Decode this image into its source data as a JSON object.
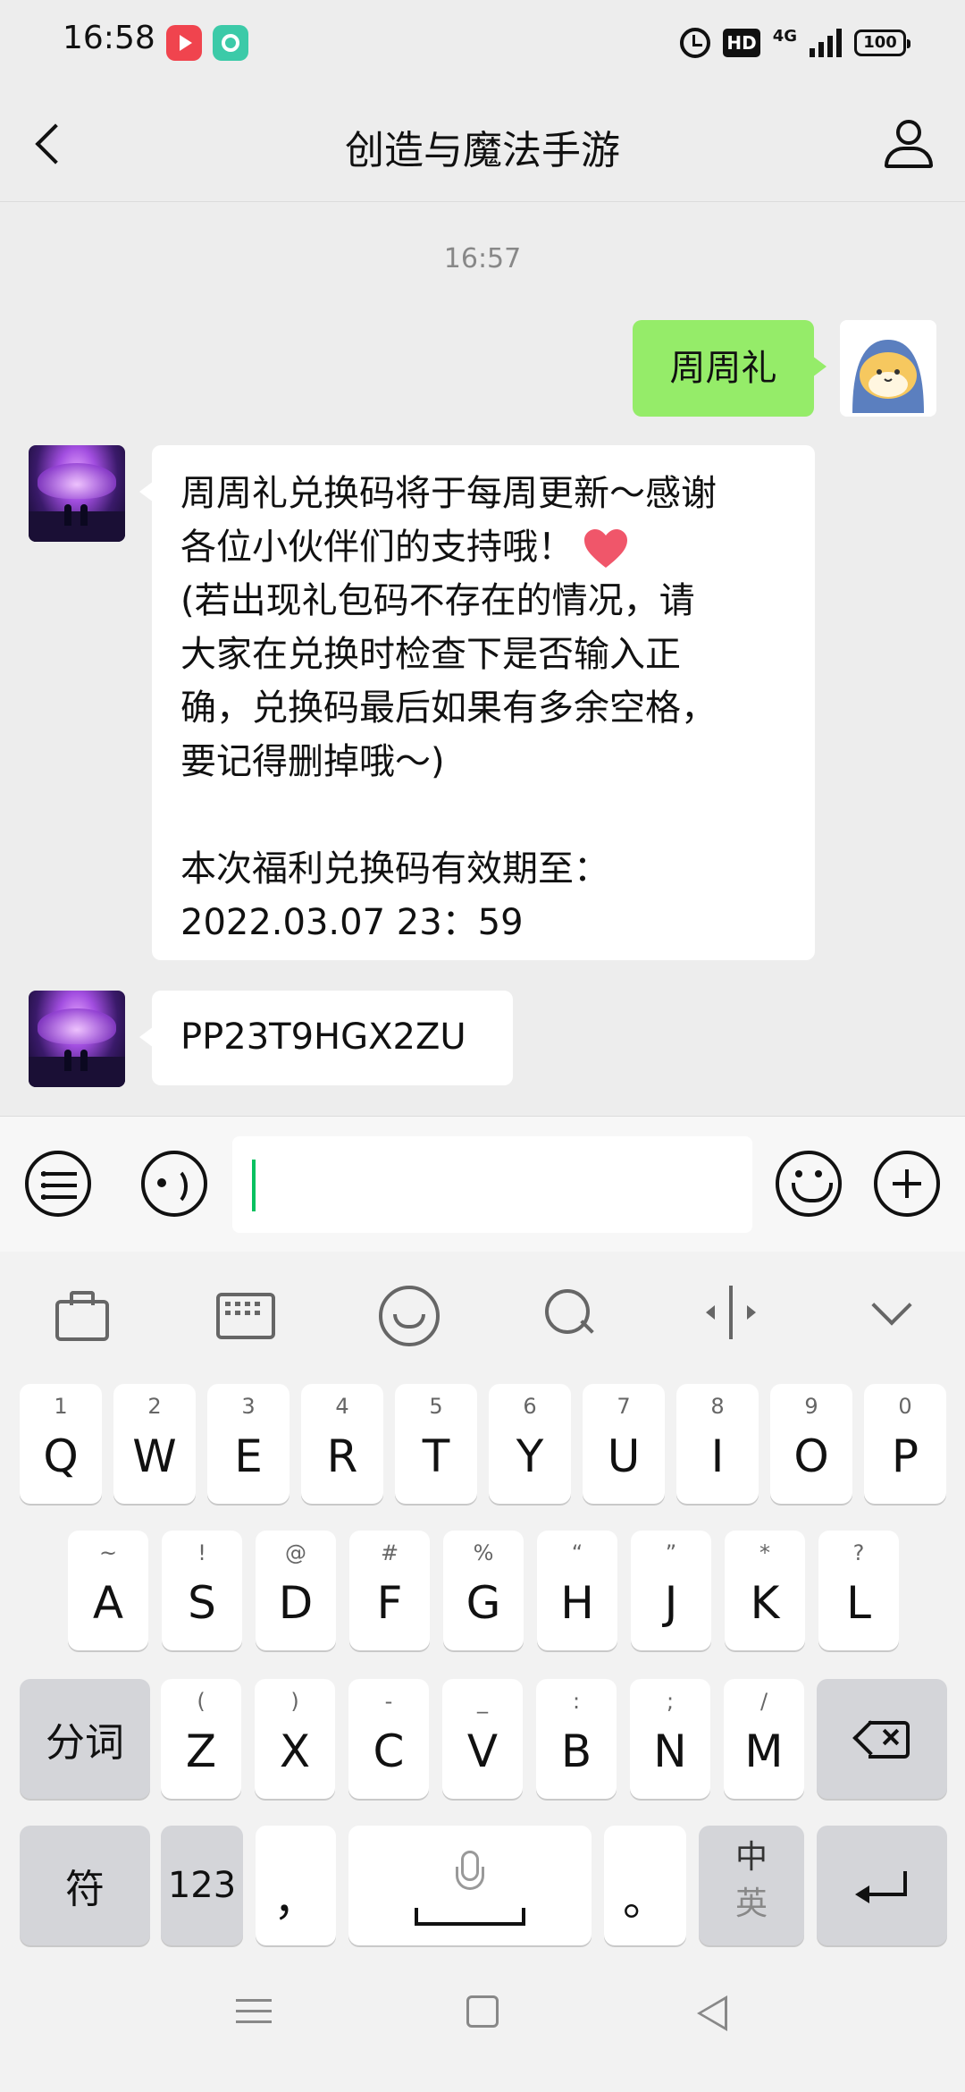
{
  "status_bar": {
    "time": "16:58",
    "network": "4G",
    "hd": "HD",
    "battery": "100"
  },
  "header": {
    "title": "创造与魔法手游"
  },
  "conversation": {
    "timestamp": "16:57",
    "messages": [
      {
        "sender": "me",
        "text": "周周礼"
      },
      {
        "sender": "game",
        "lines": [
          "周周礼兑换码将于每周更新～感谢",
          "各位小伙伴们的支持哦！",
          "(若出现礼包码不存在的情况，请",
          "大家在兑换时检查下是否输入正",
          "确，兑换码最后如果有多余空格，",
          "要记得删掉哦～)",
          "",
          "本次福利兑换码有效期至：",
          "2022.03.07  23：59"
        ]
      },
      {
        "sender": "game",
        "text": "PP23T9HGX2ZU"
      }
    ]
  },
  "input": {
    "value": ""
  },
  "keyboard": {
    "row1": [
      {
        "sub": "1",
        "key": "Q"
      },
      {
        "sub": "2",
        "key": "W"
      },
      {
        "sub": "3",
        "key": "E"
      },
      {
        "sub": "4",
        "key": "R"
      },
      {
        "sub": "5",
        "key": "T"
      },
      {
        "sub": "6",
        "key": "Y"
      },
      {
        "sub": "7",
        "key": "U"
      },
      {
        "sub": "8",
        "key": "I"
      },
      {
        "sub": "9",
        "key": "O"
      },
      {
        "sub": "0",
        "key": "P"
      }
    ],
    "row2": [
      {
        "sub": "~",
        "key": "A"
      },
      {
        "sub": "!",
        "key": "S"
      },
      {
        "sub": "@",
        "key": "D"
      },
      {
        "sub": "#",
        "key": "F"
      },
      {
        "sub": "%",
        "key": "G"
      },
      {
        "sub": "“",
        "key": "H"
      },
      {
        "sub": "”",
        "key": "J"
      },
      {
        "sub": "*",
        "key": "K"
      },
      {
        "sub": "?",
        "key": "L"
      }
    ],
    "row3": [
      {
        "sub": "(",
        "key": "Z"
      },
      {
        "sub": ")",
        "key": "X"
      },
      {
        "sub": "-",
        "key": "C"
      },
      {
        "sub": "_",
        "key": "V"
      },
      {
        "sub": ":",
        "key": "B"
      },
      {
        "sub": ";",
        "key": "N"
      },
      {
        "sub": "/",
        "key": "M"
      }
    ],
    "segment_label": "分词",
    "symbol_label": "符",
    "number_label": "123",
    "comma": "，",
    "period": "。",
    "lang_cn": "中",
    "lang_en": "英"
  },
  "colors": {
    "bubble_me": "#95ec69",
    "bubble_in": "#ffffff",
    "background": "#ededed",
    "caret": "#07c160"
  }
}
